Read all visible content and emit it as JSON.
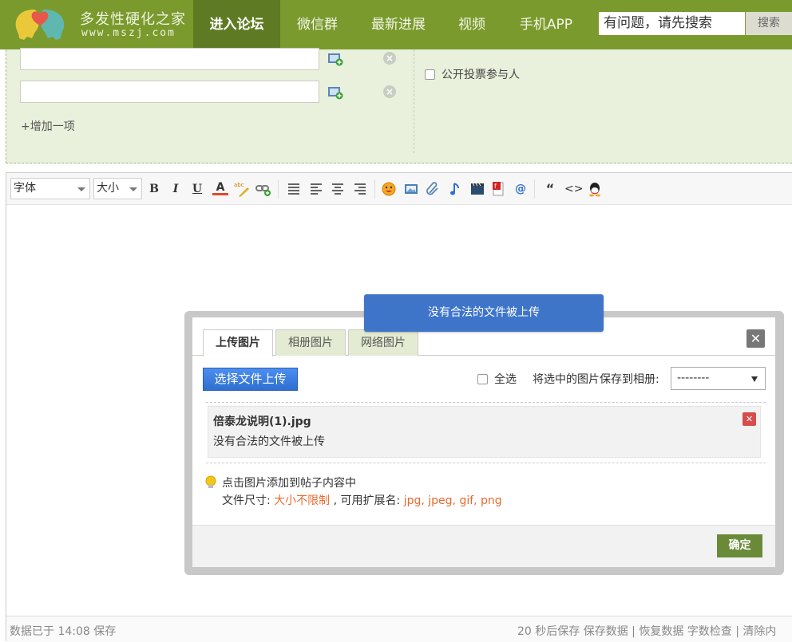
{
  "site": {
    "logo_title": "多发性硬化之家",
    "logo_url": "www.mszj.com",
    "colors": {
      "nav_bg": "#7a9a2e",
      "nav_active": "#5e7a22",
      "poll_bg": "#e9f0dc",
      "ok_button": "#6a8a3a",
      "toast_bg": "#3f75c9",
      "highlight": "#e86a2f"
    }
  },
  "nav": {
    "items": [
      {
        "label": "进入论坛",
        "active": true
      },
      {
        "label": "微信群",
        "active": false
      },
      {
        "label": "最新进展",
        "active": false
      },
      {
        "label": "视频",
        "active": false
      },
      {
        "label": "手机APP",
        "active": false
      }
    ],
    "search_value": "有问题，请先搜索",
    "search_button": "搜索"
  },
  "poll": {
    "add_option": "+增加一项",
    "public_voters": "公开投票参与人"
  },
  "toolbar": {
    "font_label": "字体",
    "size_label": "大小",
    "bold": "B",
    "italic": "I",
    "underline": "U",
    "font_color": "A",
    "quote": "“",
    "code": "<>"
  },
  "status": {
    "left": "数据已于 14:08 保存",
    "right": "20 秒后保存 保存数据 | 恢复数据    字数检查 | 清除内"
  },
  "toast": {
    "message": "没有合法的文件被上传"
  },
  "upload_dialog": {
    "tabs": [
      {
        "label": "上传图片",
        "active": true
      },
      {
        "label": "相册图片",
        "active": false
      },
      {
        "label": "网络图片",
        "active": false
      }
    ],
    "close": "✕",
    "choose_button": "选择文件上传",
    "select_all": "全选",
    "save_to_album_label": "将选中的图片保存到相册:",
    "album_selected": "--------",
    "file": {
      "name": "倍泰龙说明(1).jpg",
      "error": "没有合法的文件被上传",
      "delete": "✕"
    },
    "tip_line1": "点击图片添加到帖子内容中",
    "tip_size_label": "文件尺寸: ",
    "tip_size_value": "大小不限制",
    "tip_ext_label": " , 可用扩展名: ",
    "tip_ext_value": "jpg, jpeg, gif, png",
    "ok_button": "确定"
  }
}
